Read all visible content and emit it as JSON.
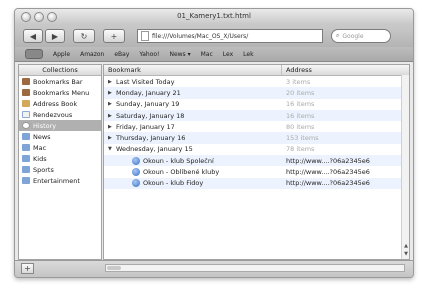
{
  "window": {
    "title": "01_Kamery1.txt.html"
  },
  "toolbar": {
    "back_glyph": "◀",
    "forward_glyph": "▶",
    "reload_glyph": "↻",
    "add_glyph": "+",
    "url": "file:///Volumes/Mac_OS_X/Users/",
    "search_placeholder": "Google"
  },
  "bookmarks_bar": {
    "items": [
      "Apple",
      "Amazon",
      "eBay",
      "Yahoo!",
      "News ▾",
      "Mac",
      "Lex",
      "Lek"
    ]
  },
  "collections": {
    "header": "Collections",
    "items": [
      {
        "label": "Bookmarks Bar",
        "icon": "book-icon"
      },
      {
        "label": "Bookmarks Menu",
        "icon": "book-icon"
      },
      {
        "label": "Address Book",
        "icon": "address-book-icon"
      },
      {
        "label": "Rendezvous",
        "icon": "rss-icon"
      },
      {
        "label": "History",
        "icon": "history-icon",
        "selected": true
      },
      {
        "label": "News",
        "icon": "folder-icon"
      },
      {
        "label": "Mac",
        "icon": "folder-icon"
      },
      {
        "label": "Kids",
        "icon": "folder-icon"
      },
      {
        "label": "Sports",
        "icon": "folder-icon"
      },
      {
        "label": "Entertainment",
        "icon": "folder-icon"
      }
    ]
  },
  "bookmarks": {
    "header_bookmark": "Bookmark",
    "header_address": "Address",
    "rows": [
      {
        "label": "Last Visited Today",
        "addr": "3 items",
        "tri": "▶",
        "child": false,
        "muted": true
      },
      {
        "label": "Monday, January 21",
        "addr": "20 items",
        "tri": "▶",
        "child": false,
        "muted": true
      },
      {
        "label": "Sunday, January 19",
        "addr": "16 items",
        "tri": "▶",
        "child": false,
        "muted": true
      },
      {
        "label": "Saturday, January 18",
        "addr": "16 items",
        "tri": "▶",
        "child": false,
        "muted": true
      },
      {
        "label": "Friday, January 17",
        "addr": "80 items",
        "tri": "▶",
        "child": false,
        "muted": true
      },
      {
        "label": "Thursday, January 16",
        "addr": "153 items",
        "tri": "▶",
        "child": false,
        "muted": true
      },
      {
        "label": "Wednesday, January 15",
        "addr": "78 items",
        "tri": "▼",
        "child": false,
        "muted": true
      },
      {
        "label": "Okoun - klub Společní",
        "addr": "http://www....?06a2345e6",
        "tri": "",
        "child": true,
        "muted": false
      },
      {
        "label": "Okoun - Oblíbené kluby",
        "addr": "http://www....?06a2345e6",
        "tri": "",
        "child": true,
        "muted": false
      },
      {
        "label": "Okoun - klub Fidoy",
        "addr": "http://www....?06a2345e6",
        "tri": "",
        "child": true,
        "muted": false
      }
    ]
  },
  "bottom": {
    "add_glyph": "+"
  }
}
